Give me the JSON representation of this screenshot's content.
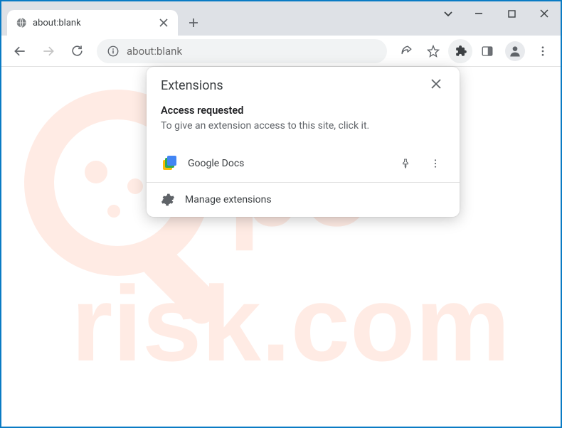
{
  "tab": {
    "label": "about:blank"
  },
  "window": {
    "chevron": "⌄"
  },
  "omnibox": {
    "address": "about:blank"
  },
  "popup": {
    "title": "Extensions",
    "section_heading": "Access requested",
    "section_text": "To give an extension access to this site, click it.",
    "manage_label": "Manage extensions",
    "extensions": [
      {
        "name": "Google Docs"
      }
    ]
  },
  "watermark": {
    "line1": "pc",
    "line2": "risk.com"
  }
}
